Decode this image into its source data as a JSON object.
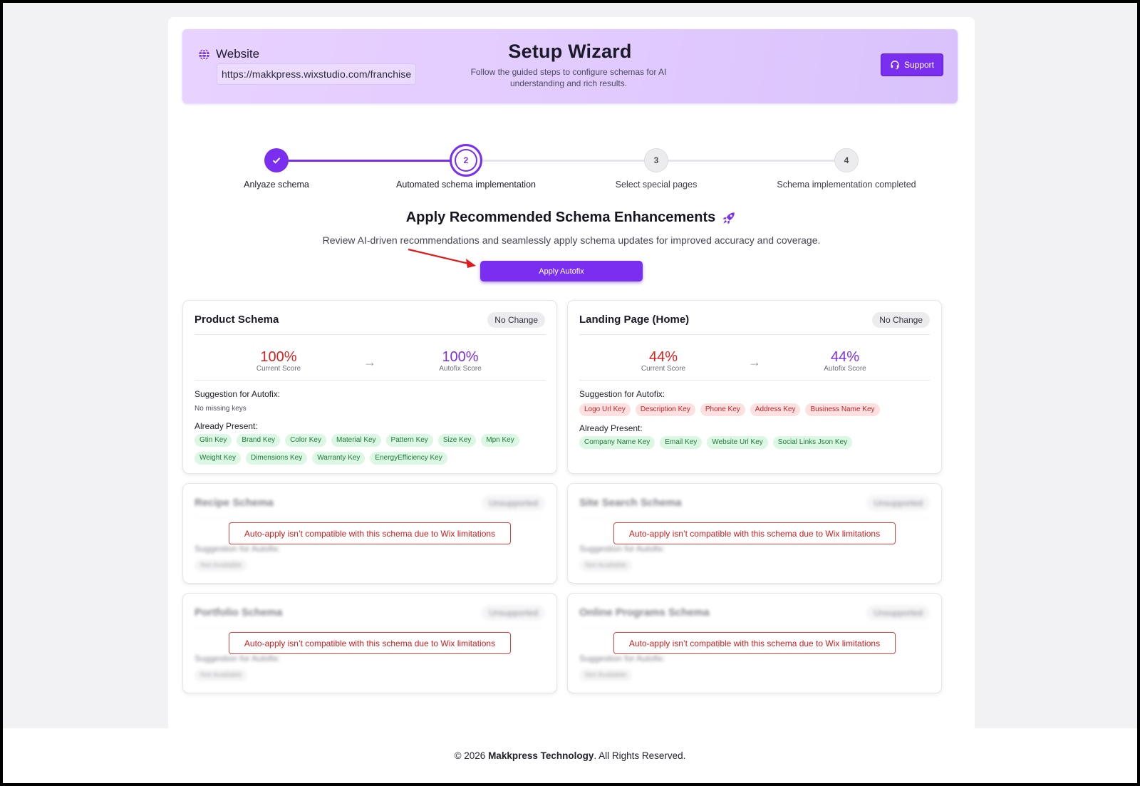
{
  "header": {
    "site_label": "Website",
    "site_url": "https://makkpress.wixstudio.com/franchise",
    "title": "Setup Wizard",
    "subtitle": "Follow the guided steps to configure schemas for AI understanding and rich results.",
    "support_label": "Support"
  },
  "stepper": {
    "steps": [
      {
        "number": "1",
        "label": "Anlyaze schema",
        "state": "done"
      },
      {
        "number": "2",
        "label": "Automated schema implementation",
        "state": "active"
      },
      {
        "number": "3",
        "label": "Select special pages",
        "state": "todo"
      },
      {
        "number": "4",
        "label": "Schema implementation completed",
        "state": "todo"
      }
    ]
  },
  "section": {
    "title": "Apply Recommended Schema Enhancements",
    "subtitle": "Review AI-driven recommendations and seamlessly apply schema updates for improved accuracy and coverage.",
    "autofix_label": "Apply Autofix"
  },
  "cards": {
    "product": {
      "title": "Product Schema",
      "badge": "No Change",
      "current_score": "100%",
      "current_label": "Current Score",
      "autofix_score": "100%",
      "autofix_label": "Autofix Score",
      "suggestion_label": "Suggestion for Autofix:",
      "suggestion_empty": "No missing keys",
      "already_label": "Already Present:",
      "present_keys": [
        "Gtin Key",
        "Brand Key",
        "Color Key",
        "Material Key",
        "Pattern Key",
        "Size Key",
        "Mpn Key",
        "Weight Key",
        "Dimensions Key",
        "Warranty Key",
        "EnergyEfficiency Key"
      ]
    },
    "landing": {
      "title": "Landing Page (Home)",
      "badge": "No Change",
      "current_score": "44%",
      "current_label": "Current Score",
      "autofix_score": "44%",
      "autofix_label": "Autofix Score",
      "suggestion_label": "Suggestion for Autofix:",
      "missing_keys": [
        "Logo Url Key",
        "Description Key",
        "Phone Key",
        "Address Key",
        "Business Name Key"
      ],
      "already_label": "Already Present:",
      "present_keys": [
        "Company Name Key",
        "Email Key",
        "Website Url Key",
        "Social Links Json Key"
      ]
    },
    "recipe": {
      "title": "Recipe Schema",
      "badge": "Unsupported",
      "suggestion_label": "Suggestion for Autofix:",
      "pill": "Not Available",
      "note": "Auto-apply isn’t compatible with this schema due to Wix limitations"
    },
    "sitesearch": {
      "title": "Site Search Schema",
      "badge": "Unsupported",
      "suggestion_label": "Suggestion for Autofix:",
      "pill": "Not Available",
      "note": "Auto-apply isn’t compatible with this schema due to Wix limitations"
    },
    "portfolio": {
      "title": "Portfolio Schema",
      "badge": "Unsupported",
      "suggestion_label": "Suggestion for Autofix:",
      "pill": "Not Available",
      "note": "Auto-apply isn’t compatible with this schema due to Wix limitations"
    },
    "online": {
      "title": "Online Programs Schema",
      "badge": "Unsupported",
      "suggestion_label": "Suggestion for Autofix:",
      "pill": "Not Available",
      "note": "Auto-apply isn’t compatible with this schema due to Wix limitations"
    }
  },
  "footer": {
    "prefix": "© 2026 ",
    "company": "Makkpress Technology",
    "suffix": ". All Rights Reserved."
  },
  "colors": {
    "accent": "#7a2ff0",
    "danger": "#dc1f1f",
    "success_bg": "#dcf7e3"
  },
  "icons": {
    "site": "globe-icon",
    "support": "headset-icon",
    "section": "rocket-icon",
    "step_done": "check-icon",
    "score_arrow": "arrow-right-icon"
  }
}
